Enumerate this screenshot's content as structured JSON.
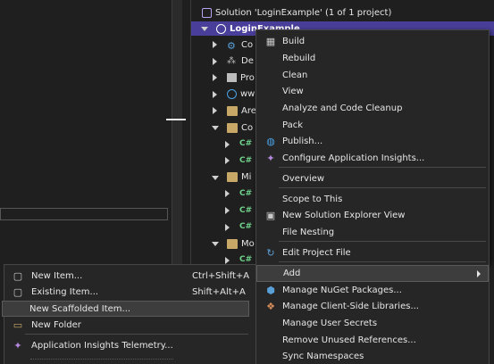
{
  "solution_explorer": {
    "solution_label": "Solution 'LoginExample' (1 of 1 project)",
    "project_label": "LoginExample",
    "rows": [
      {
        "label": "Co",
        "icon": "gear-icon",
        "expand": "collapsed"
      },
      {
        "label": "De",
        "icon": "dependencies-icon",
        "expand": "collapsed"
      },
      {
        "label": "Pro",
        "icon": "properties-icon",
        "expand": "collapsed"
      },
      {
        "label": "ww",
        "icon": "globe-icon",
        "expand": "collapsed"
      },
      {
        "label": "Are",
        "icon": "folder-icon",
        "expand": "collapsed"
      },
      {
        "label": "Co",
        "icon": "folder-icon",
        "expand": "expanded"
      },
      {
        "label": "",
        "icon": "csharp-file-icon",
        "expand": "collapsed"
      },
      {
        "label": "",
        "icon": "csharp-file-icon",
        "expand": "collapsed"
      },
      {
        "label": "Mi",
        "icon": "folder-icon",
        "expand": "expanded"
      },
      {
        "label": "",
        "icon": "csharp-file-icon",
        "expand": "collapsed"
      },
      {
        "label": "",
        "icon": "csharp-file-icon",
        "expand": "collapsed"
      },
      {
        "label": "",
        "icon": "csharp-file-icon",
        "expand": "collapsed"
      },
      {
        "label": "Mo",
        "icon": "folder-icon",
        "expand": "expanded"
      },
      {
        "label": "",
        "icon": "csharp-file-icon",
        "expand": "collapsed"
      },
      {
        "label": "",
        "icon": "csharp-file-icon",
        "expand": "collapsed"
      }
    ]
  },
  "context_menu": {
    "items": [
      {
        "label": "Build",
        "icon": "build-icon"
      },
      {
        "label": "Rebuild",
        "icon": ""
      },
      {
        "label": "Clean",
        "icon": ""
      },
      {
        "label": "View",
        "icon": ""
      },
      {
        "label": "Analyze and Code Cleanup",
        "icon": ""
      },
      {
        "label": "Pack",
        "icon": ""
      },
      {
        "label": "Publish...",
        "icon": "publish-globe-icon"
      },
      {
        "label": "Configure Application Insights...",
        "icon": "app-insights-icon"
      },
      {
        "label": "Overview",
        "icon": ""
      },
      {
        "label": "Scope to This",
        "icon": ""
      },
      {
        "label": "New Solution Explorer View",
        "icon": "new-view-icon"
      },
      {
        "label": "File Nesting",
        "icon": ""
      },
      {
        "label": "Edit Project File",
        "icon": "edit-file-icon"
      },
      {
        "label": "Add",
        "icon": "",
        "submenu": true,
        "highlighted": true
      },
      {
        "label": "Manage NuGet Packages...",
        "icon": "nuget-icon"
      },
      {
        "label": "Manage Client-Side Libraries...",
        "icon": "libraries-icon"
      },
      {
        "label": "Manage User Secrets",
        "icon": ""
      },
      {
        "label": "Remove Unused References...",
        "icon": ""
      },
      {
        "label": "Sync Namespaces",
        "icon": ""
      }
    ]
  },
  "add_submenu": {
    "items": [
      {
        "label": "New Item...",
        "shortcut": "Ctrl+Shift+A",
        "icon": "new-item-icon"
      },
      {
        "label": "Existing Item...",
        "shortcut": "Shift+Alt+A",
        "icon": "existing-item-icon"
      },
      {
        "label": "New Scaffolded Item...",
        "shortcut": "",
        "icon": "",
        "highlighted": true
      },
      {
        "label": "New Folder",
        "shortcut": "",
        "icon": "new-folder-icon"
      },
      {
        "label": "Application Insights Telemetry...",
        "shortcut": "",
        "icon": "app-insights-icon"
      }
    ]
  },
  "colors": {
    "background": "#1f1f1f",
    "selection": "#493f9a",
    "menu_bg": "#262626",
    "menu_highlight": "#3d3d3d"
  }
}
